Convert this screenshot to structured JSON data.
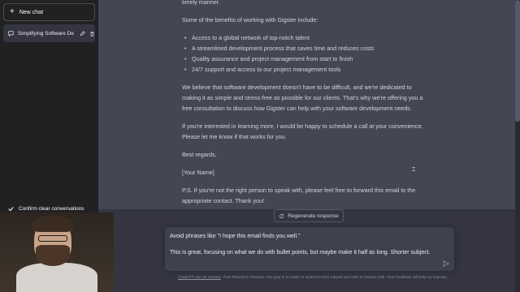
{
  "sidebar": {
    "new_chat_label": "New chat",
    "chat_item_title": "Simplifying Software De",
    "confirm_label": "Confirm clear conversations"
  },
  "message": {
    "partial_top": "timely manner.",
    "benefits_intro": "Some of the benefits of working with Gigster include:",
    "bullets": [
      "Access to a global network of top-notch talent",
      "A streamlined development process that saves time and reduces costs",
      "Quality assurance and project management from start to finish",
      "24/7 support and access to our project management tools"
    ],
    "para_believe": "We believe that software development doesn't have to be difficult, and we're dedicated to making it as simple and stress-free as possible for our clients. That's why we're offering you a free consultation to discuss how Gigster can help with your software development needs.",
    "para_interested": "If you're interested in learning more, I would be happy to schedule a call at your convenience. Please let me know if that works for you.",
    "closing": "Best regards,",
    "name": "[Your Name]",
    "ps": "P.S. If you're not the right person to speak with, please feel free to forward this email to the appropriate contact. Thank you!"
  },
  "regenerate_label": "Regenerate response",
  "input": {
    "line1": "Avoid phrases like \"I hope this email finds you well.\"",
    "line2": "This is great, focusing on what we do with bullet points, but maybe make it half as long. Shorter subject."
  },
  "footer": {
    "link_text": "ChatGPT Jan 30 Version",
    "text": ". Free Research Preview. Our goal is to make AI systems more natural and safe to interact with. Your feedback will help us improve."
  },
  "colors": {
    "sidebar_bg": "#202123",
    "main_bg": "#343541",
    "message_bg": "#444654",
    "input_bg": "#40414f"
  },
  "icons": [
    "plus-icon",
    "chat-bubble-icon",
    "pencil-icon",
    "trash-icon",
    "check-icon",
    "refresh-icon",
    "send-icon"
  ]
}
